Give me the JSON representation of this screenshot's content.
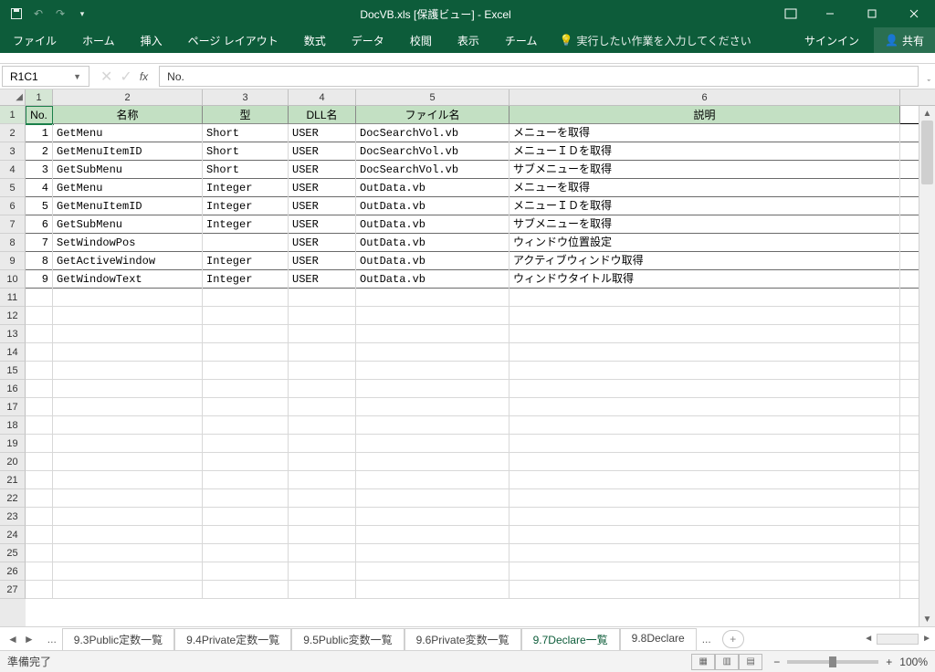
{
  "title": "DocVB.xls  [保護ビュー] - Excel",
  "menu": {
    "file": "ファイル",
    "home": "ホーム",
    "insert": "挿入",
    "pagelayout": "ページ レイアウト",
    "formulas": "数式",
    "data": "データ",
    "review": "校閲",
    "view": "表示",
    "team": "チーム",
    "tellme": "実行したい作業を入力してください",
    "signin": "サインイン",
    "share": "共有"
  },
  "formula": {
    "namebox": "R1C1",
    "content": "No."
  },
  "columns": {
    "labels": [
      "1",
      "2",
      "3",
      "4",
      "5",
      "6"
    ],
    "headers": [
      "No.",
      "名称",
      "型",
      "DLL名",
      "ファイル名",
      "説明"
    ]
  },
  "rows": [
    {
      "no": "1",
      "name": "GetMenu",
      "type": "Short",
      "dll": "USER",
      "file": "DocSearchVol.vb",
      "desc": "メニューを取得"
    },
    {
      "no": "2",
      "name": "GetMenuItemID",
      "type": "Short",
      "dll": "USER",
      "file": "DocSearchVol.vb",
      "desc": "メニューＩＤを取得"
    },
    {
      "no": "3",
      "name": "GetSubMenu",
      "type": "Short",
      "dll": "USER",
      "file": "DocSearchVol.vb",
      "desc": "サブメニューを取得"
    },
    {
      "no": "4",
      "name": "GetMenu",
      "type": "Integer",
      "dll": "USER",
      "file": "OutData.vb",
      "desc": "メニューを取得"
    },
    {
      "no": "5",
      "name": "GetMenuItemID",
      "type": "Integer",
      "dll": "USER",
      "file": "OutData.vb",
      "desc": "メニューＩＤを取得"
    },
    {
      "no": "6",
      "name": "GetSubMenu",
      "type": "Integer",
      "dll": "USER",
      "file": "OutData.vb",
      "desc": "サブメニューを取得"
    },
    {
      "no": "7",
      "name": "SetWindowPos",
      "type": "",
      "dll": "USER",
      "file": "OutData.vb",
      "desc": "ウィンドウ位置設定"
    },
    {
      "no": "8",
      "name": "GetActiveWindow",
      "type": "Integer",
      "dll": "USER",
      "file": "OutData.vb",
      "desc": "アクティブウィンドウ取得"
    },
    {
      "no": "9",
      "name": "GetWindowText",
      "type": "Integer",
      "dll": "USER",
      "file": "OutData.vb",
      "desc": "ウィンドウタイトル取得"
    }
  ],
  "blank_rows": 17,
  "first_row_number": 1,
  "sheets": {
    "tabs": [
      "9.3Public定数一覧",
      "9.4Private定数一覧",
      "9.5Public変数一覧",
      "9.6Private変数一覧",
      "9.7Declare一覧",
      "9.8Declare"
    ],
    "active_index": 4
  },
  "status": {
    "ready": "準備完了",
    "zoom": "100%"
  }
}
